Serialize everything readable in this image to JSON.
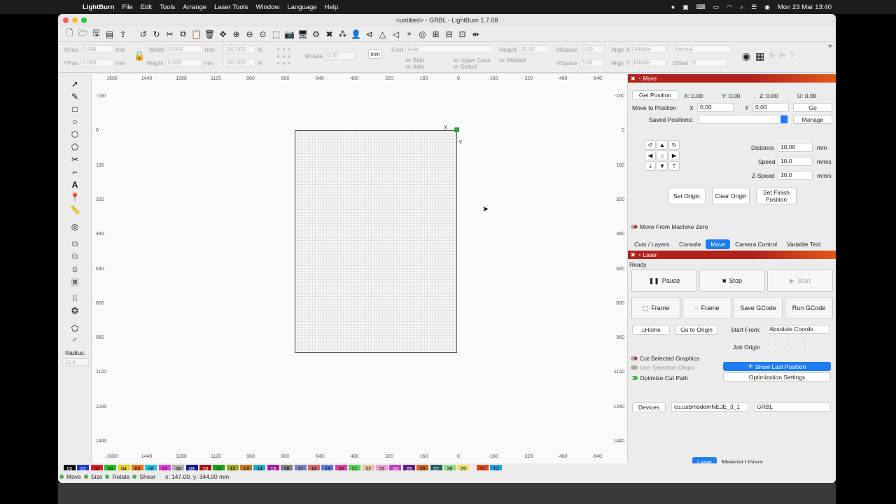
{
  "menubar": {
    "app": "LightBurn",
    "items": [
      "File",
      "Edit",
      "Tools",
      "Arrange",
      "Laser Tools",
      "Window",
      "Language",
      "Help"
    ],
    "clock": "Mon 23 Mar  13:40"
  },
  "window": {
    "title": "<untitled> - GRBL - LightBurn 1.7.08"
  },
  "props": {
    "xpos_label": "XPos",
    "xpos": "0.000",
    "ypos_label": "YPos",
    "ypos": "0.000",
    "unit": "mm",
    "width_label": "Width",
    "width": "0.000",
    "height_label": "Height",
    "height": "0.000",
    "scale_w": "100.000",
    "scale_h": "100.000",
    "pct": "%",
    "rotate_label": "Rotate",
    "rotate": "0.00",
    "mm_btn": "mm",
    "font_label": "Font",
    "font": "Arial",
    "fheight_label": "Height",
    "fheight": "25.00",
    "hspace_label": "HSpace",
    "hspace": "0.00",
    "vspace_label": "VSpace",
    "vspace": "0.00",
    "alignx_label": "Align X",
    "alignx": "Middle",
    "aligny_label": "Align Y",
    "aligny": "Middle",
    "normal": "Normal",
    "offset_label": "Offset",
    "offset": "0",
    "bold": "Bold",
    "italic": "Italic",
    "upper": "Upper Case",
    "distort": "Distort",
    "welded": "Welded"
  },
  "ruler": {
    "x_labels": [
      "1600",
      "1440",
      "1280",
      "1120",
      "960",
      "800",
      "640",
      "480",
      "320",
      "160",
      "0",
      "-160",
      "-320",
      "-480",
      "-640"
    ],
    "y_labels": [
      "-160",
      "0",
      "160",
      "320",
      "480",
      "640",
      "800",
      "960",
      "1120",
      "1280",
      "1440"
    ]
  },
  "canvas": {
    "x_marker": "X",
    "y_marker": "Y"
  },
  "lefttools": {
    "radius_label": "Radius:",
    "radius_value": "10.0"
  },
  "move_panel": {
    "title": "Move",
    "get_position": "Get Position",
    "x": "X: 0.00",
    "y": "Y: 0.00",
    "z": "Z: 0.00",
    "u": "U: 0.00",
    "move_to": "Move to Position",
    "mx_label": "X",
    "mx": "0,00",
    "my_label": "Y",
    "my": "0,00",
    "go": "Go",
    "saved_label": "Saved Positions:",
    "manage": "Manage",
    "distance_label": "Distance",
    "distance": "10,00",
    "distance_unit": "mm",
    "speed_label": "Speed",
    "speed": "10,0",
    "speed_unit": "mm/s",
    "zspeed_label": "Z-Speed",
    "zspeed": "10,0",
    "zspeed_unit": "mm/s",
    "set_origin": "Set Origin",
    "clear_origin": "Clear Origin",
    "set_finish": "Set Finish Position",
    "move_from_zero": "Move From Machine Zero"
  },
  "tabs_top": [
    "Cuts / Layers",
    "Console",
    "Move",
    "Camera Control",
    "Variable Text"
  ],
  "laser_panel": {
    "title": "Laser",
    "status": "Ready",
    "pause": "Pause",
    "stop": "Stop",
    "start": "Start",
    "frame1": "Frame",
    "frame2": "Frame",
    "save_gcode": "Save GCode",
    "run_gcode": "Run GCode",
    "home": "Home",
    "go_origin": "Go to Origin",
    "start_from_label": "Start From:",
    "start_from": "Absolute Coords",
    "job_origin": "Job Origin",
    "cut_selected": "Cut Selected Graphics",
    "use_selection": "Use Selection Origin",
    "show_last": "Show Last Position",
    "optimize": "Optimize Cut Path",
    "opt_settings": "Optimization Settings",
    "devices": "Devices",
    "port": "cu.usbmodemNEJE_3_1",
    "device": "GRBL"
  },
  "tabs_bottom": [
    "Laser",
    "Material Library"
  ],
  "palette": [
    {
      "label": "00",
      "color": "#000000"
    },
    {
      "label": "01",
      "color": "#1f3bd6"
    },
    {
      "label": "02",
      "color": "#e02020"
    },
    {
      "label": "03",
      "color": "#22c022"
    },
    {
      "label": "04",
      "color": "#e8d020"
    },
    {
      "label": "05",
      "color": "#e87018"
    },
    {
      "label": "06",
      "color": "#20c8d8"
    },
    {
      "label": "07",
      "color": "#e040e0"
    },
    {
      "label": "08",
      "color": "#b0b0b0"
    },
    {
      "label": "09",
      "color": "#1a1a90"
    },
    {
      "label": "10",
      "color": "#a01818"
    },
    {
      "label": "11",
      "color": "#20a020"
    },
    {
      "label": "12",
      "color": "#a0a020"
    },
    {
      "label": "13",
      "color": "#c07818"
    },
    {
      "label": "14",
      "color": "#20a8d0"
    },
    {
      "label": "15",
      "color": "#a020a0"
    },
    {
      "label": "16",
      "color": "#808080"
    },
    {
      "label": "17",
      "color": "#8080c8"
    },
    {
      "label": "18",
      "color": "#d06868"
    },
    {
      "label": "19",
      "color": "#5878e0"
    },
    {
      "label": "20",
      "color": "#e040a0"
    },
    {
      "label": "21",
      "color": "#58d058"
    },
    {
      "label": "22",
      "color": "#e8c0a0"
    },
    {
      "label": "23",
      "color": "#f0a0d0"
    },
    {
      "label": "24",
      "color": "#c040c0"
    },
    {
      "label": "25",
      "color": "#602080"
    },
    {
      "label": "26",
      "color": "#c86020"
    },
    {
      "label": "27",
      "color": "#206060"
    },
    {
      "label": "28",
      "color": "#90d890"
    },
    {
      "label": "29",
      "color": "#e8e060"
    },
    {
      "label": "T1",
      "color": "#e04818"
    },
    {
      "label": "T2",
      "color": "#20a0e0"
    }
  ],
  "status": {
    "move": "Move",
    "size": "Size",
    "rotate": "Rotate",
    "shear": "Shear",
    "coords": "x: 147.00, y: 344.00 mm"
  }
}
